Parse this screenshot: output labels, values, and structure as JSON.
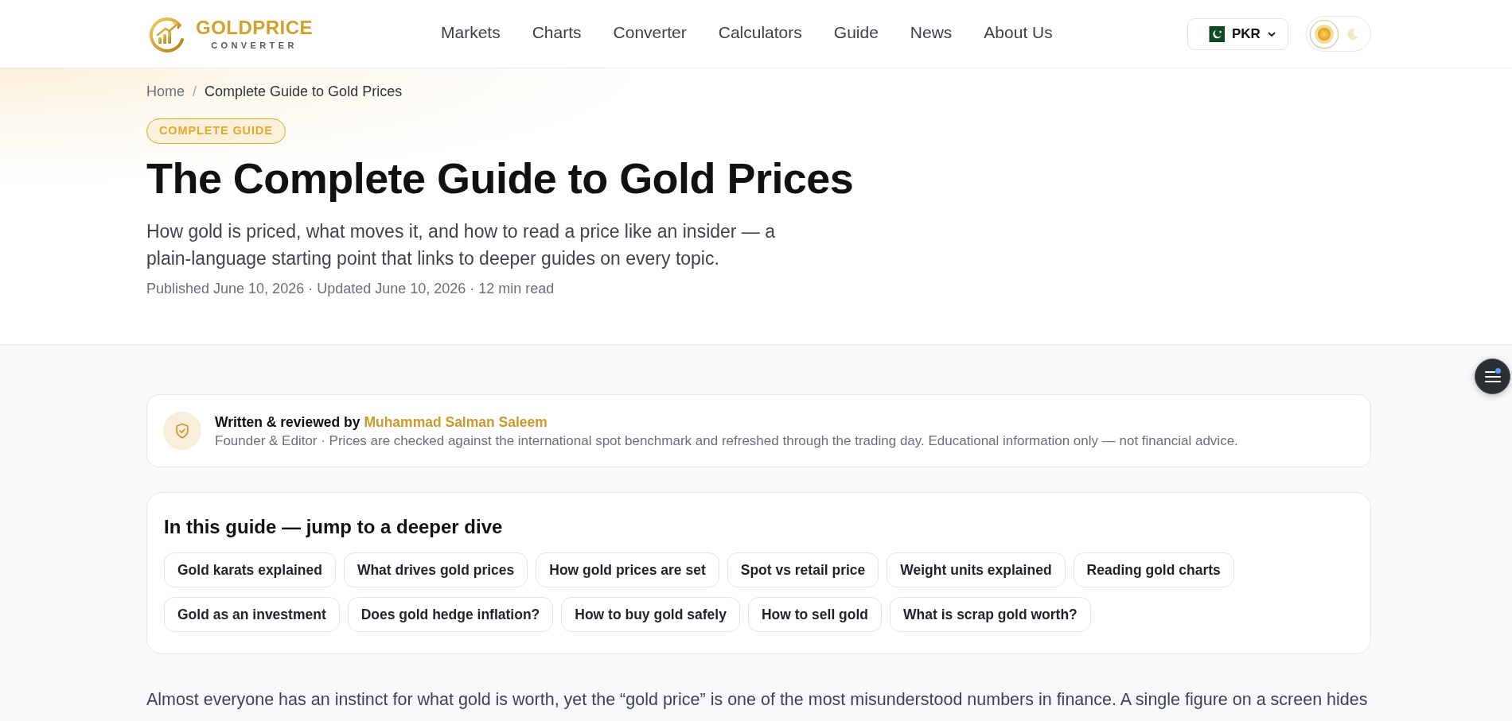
{
  "header": {
    "logo": {
      "title": "GOLDPRICE",
      "subtitle": "CONVERTER"
    },
    "nav": [
      {
        "label": "Markets"
      },
      {
        "label": "Charts"
      },
      {
        "label": "Converter"
      },
      {
        "label": "Calculators"
      },
      {
        "label": "Guide"
      },
      {
        "label": "News"
      },
      {
        "label": "About Us"
      }
    ],
    "currency": {
      "code": "PKR"
    },
    "theme_toggle": {
      "dark": false
    }
  },
  "breadcrumb": {
    "home": "Home",
    "separator": "/",
    "current": "Complete Guide to Gold Prices"
  },
  "hero": {
    "badge": "COMPLETE GUIDE",
    "title": "The Complete Guide to Gold Prices",
    "subtitle": "How gold is priced, what moves it, and how to read a price like an insider — a plain-language starting point that links to deeper guides on every topic.",
    "meta": "Published June 10, 2026 · Updated June 10, 2026 · 12 min read"
  },
  "author_card": {
    "lead": "Written & reviewed by",
    "name": "Muhammad Salman Saleem",
    "details": "Founder & Editor · Prices are checked against the international spot benchmark and refreshed through the trading day. Educational information only — not financial advice."
  },
  "guide_card": {
    "heading": "In this guide — jump to a deeper dive",
    "links": [
      {
        "label": "Gold karats explained"
      },
      {
        "label": "What drives gold prices"
      },
      {
        "label": "How gold prices are set"
      },
      {
        "label": "Spot vs retail price"
      },
      {
        "label": "Weight units explained"
      },
      {
        "label": "Reading gold charts"
      },
      {
        "label": "Gold as an investment"
      },
      {
        "label": "Does gold hedge inflation?"
      },
      {
        "label": "How to buy gold safely"
      },
      {
        "label": "How to sell gold"
      },
      {
        "label": "What is scrap gold worth?"
      }
    ]
  },
  "body": {
    "paragraph": "Almost everyone has an instinct for what gold is worth, yet the “gold price” is one of the most misunderstood numbers in finance. A single figure on a screen hides"
  }
}
